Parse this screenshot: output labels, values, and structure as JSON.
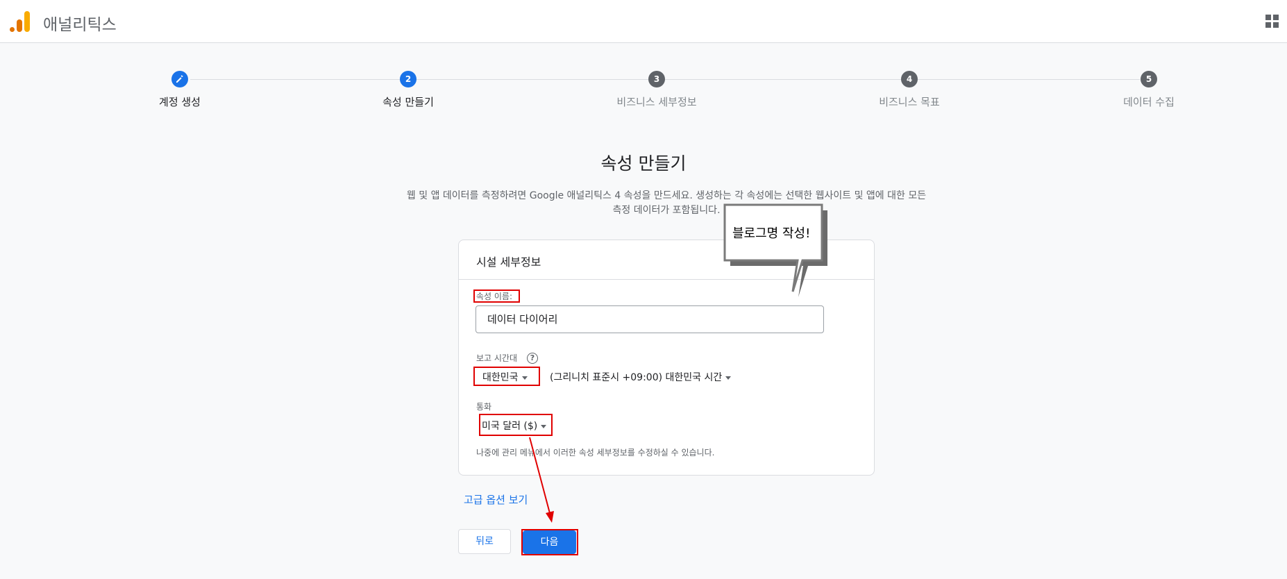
{
  "app": {
    "title": "애널리틱스"
  },
  "stepper": {
    "steps": [
      {
        "number": "",
        "label": "계정 생성",
        "state": "done"
      },
      {
        "number": "2",
        "label": "속성 만들기",
        "state": "active"
      },
      {
        "number": "3",
        "label": "비즈니스 세부정보",
        "state": "todo"
      },
      {
        "number": "4",
        "label": "비즈니스 목표",
        "state": "todo"
      },
      {
        "number": "5",
        "label": "데이터 수집",
        "state": "todo"
      }
    ]
  },
  "main": {
    "title": "속성 만들기",
    "description_line1": "웹 및 앱 데이터를 측정하려면 Google 애널리틱스 4 속성을 만드세요. 생성하는 각 속성에는 선택한 웹사이트 및 앱에 대한 모든",
    "description_line2": "측정 데이터가 포함됩니다."
  },
  "card": {
    "title": "시설 세부정보",
    "property_name_label": "속성 이름:",
    "property_name_value": "데이터 다이어리",
    "timezone_label": "보고 시간대",
    "help_symbol": "?",
    "country_value": "대한민국",
    "timezone_value": "(그리니치 표준시 +09:00) 대한민국 시간",
    "currency_label": "통화",
    "currency_value": "미국 달러 ($)",
    "note": "나중에 관리 메뉴에서 이러한 속성 세부정보를 수정하실 수 있습니다."
  },
  "actions": {
    "advanced_link": "고급 옵션 보기",
    "back_label": "뒤로",
    "next_label": "다음"
  },
  "annotation": {
    "callout_text": "블로그명 작성!",
    "highlight_color": "#e00000"
  },
  "colors": {
    "accent": "#1a73e8",
    "logo_orange": "#e37400",
    "logo_yellow": "#f9ab00"
  }
}
